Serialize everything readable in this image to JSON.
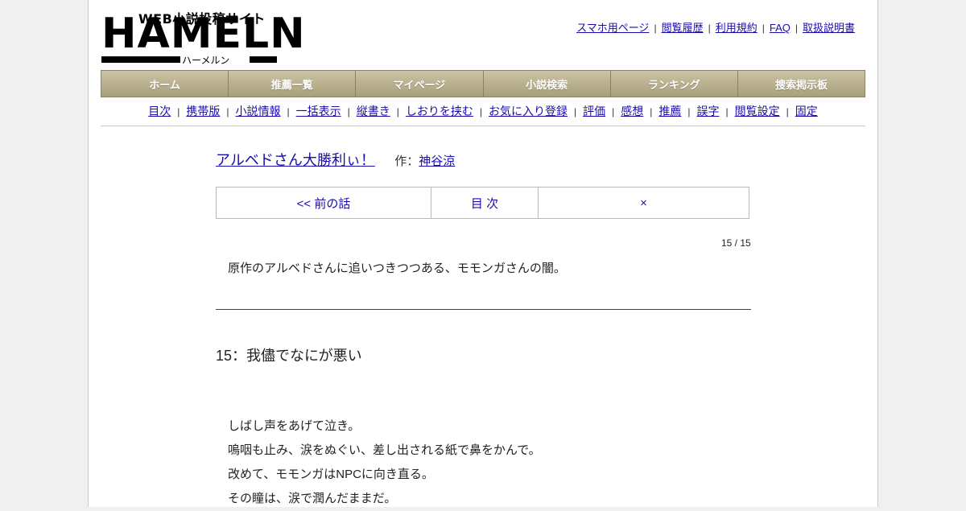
{
  "logo": {
    "tagline": "WEB小説投稿サイト",
    "wordmark": "HAMELN",
    "kana": "ハーメルン"
  },
  "toplinks": [
    "スマホ用ページ",
    "閲覧履歴",
    "利用規約",
    "FAQ",
    "取扱説明書"
  ],
  "mainnav": [
    "ホーム",
    "推薦一覧",
    "マイページ",
    "小説検索",
    "ランキング",
    "捜索掲示板"
  ],
  "subnav": [
    "目次",
    "携帯版",
    "小説情報",
    "一括表示",
    "縦書き",
    "しおりを挟む",
    "お気に入り登録",
    "評価",
    "感想",
    "推薦",
    "誤字",
    "閲覧設定",
    "固定"
  ],
  "novel": {
    "title": "アルベドさん大勝利ぃ！",
    "author_label": "作：",
    "author": "神谷涼"
  },
  "chapter_nav": {
    "prev": "<< 前の話",
    "toc": "目 次",
    "next": "×"
  },
  "counter": "15 / 15",
  "preface": "原作のアルベドさんに追いつきつつある、モモンガさんの闇。",
  "chapter_title": "15：我儘でなにが悪い",
  "body_lines": [
    "しばし声をあげて泣き。",
    "嗚咽も止み、涙をぬぐい、差し出される紙で鼻をかんで。",
    "改めて、モモンガはNPCに向き直る。",
    "その瞳は、涙で潤んだままだ。"
  ],
  "colors": {
    "link": "#1a0dab",
    "nav_gradient_top": "#cbc3a3",
    "nav_gradient_bottom": "#a89f7d",
    "page_bg": "#f0f0f0"
  }
}
